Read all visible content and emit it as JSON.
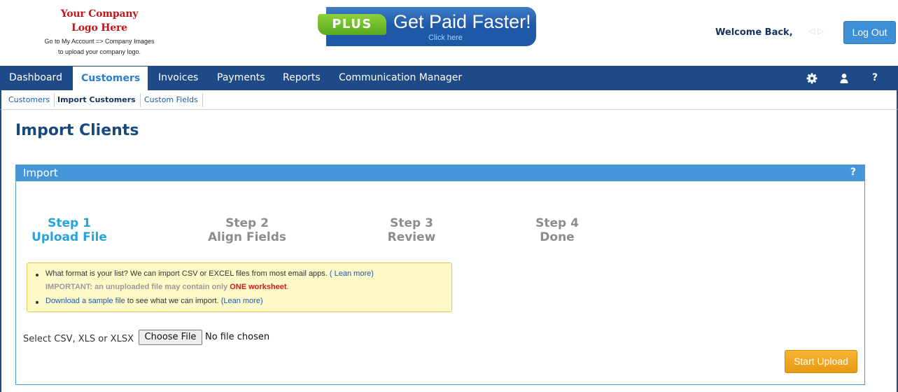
{
  "header": {
    "logo": {
      "line1": "Your Company",
      "line2": "Logo Here",
      "note1": "Go to My Account => Company Images",
      "note2": "to upload your company logo."
    },
    "banner": {
      "badge": "PLUS",
      "headline": "Get Paid Faster!",
      "cta": "Click here"
    },
    "welcome": "Welcome Back,",
    "logout_label": "Log Out"
  },
  "nav": {
    "items": [
      {
        "label": "Dashboard"
      },
      {
        "label": "Customers",
        "active": true
      },
      {
        "label": "Invoices"
      },
      {
        "label": "Payments"
      },
      {
        "label": "Reports"
      },
      {
        "label": "Communication Manager"
      }
    ],
    "icons": [
      "gear-icon",
      "user-icon",
      "help-icon"
    ],
    "help_glyph": "?"
  },
  "subnav": {
    "items": [
      {
        "label": "Customers"
      },
      {
        "label": "Import Customers",
        "active": true
      },
      {
        "label": "Custom Fields"
      }
    ]
  },
  "page": {
    "title": "Import Clients"
  },
  "panel": {
    "title": "Import",
    "help": "?",
    "steps": [
      {
        "number": "Step 1",
        "name": "Upload File",
        "current": true
      },
      {
        "number": "Step 2",
        "name": "Align Fields"
      },
      {
        "number": "Step 3",
        "name": "Review"
      },
      {
        "number": "Step 4",
        "name": "Done"
      }
    ],
    "info": {
      "line1_text": "What format is your list? We can import CSV or EXCEL files from most email apps.",
      "line1_link": "( Lean more)",
      "important_label": "IMPORTANT: an unuploaded file may contain only",
      "important_emphasis": "ONE worksheet",
      "important_end": ".",
      "line2_link": "Download a sample file",
      "line2_text": "to see what we can import.",
      "line2_link2": "(Lean more)"
    },
    "file": {
      "label": "Select CSV, XLS or XLSX",
      "button": "Choose File",
      "status": "No file chosen"
    },
    "start_upload_label": "Start Upload"
  },
  "colors": {
    "nav_bg": "#1e4a87",
    "accent": "#4596d8",
    "step_current": "#27a3dc",
    "upload_button": "#f0a51f",
    "brand_red": "#c0161a"
  }
}
